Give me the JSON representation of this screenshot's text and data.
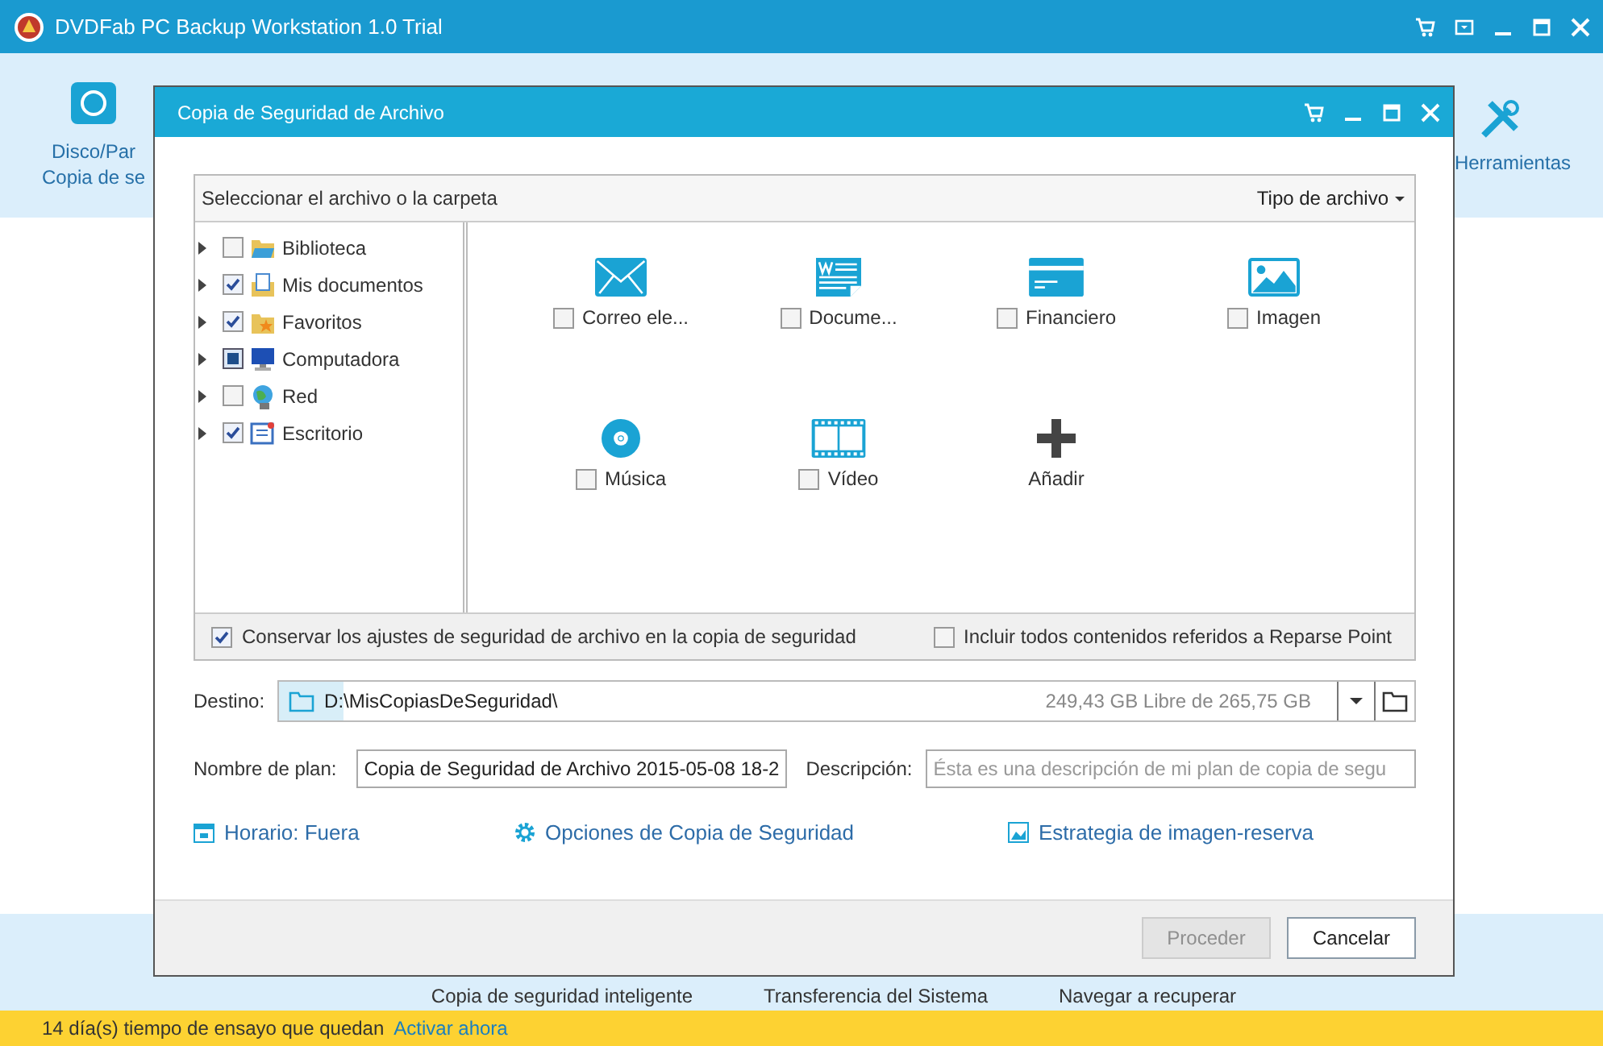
{
  "app": {
    "title": "DVDFab PC Backup Workstation 1.0 Trial",
    "toolbar_left": [
      "Disco/Par",
      "Copia de se"
    ],
    "toolbar_right": "Herramientas",
    "bottom_links": [
      "Copia de seguridad inteligente",
      "Transferencia del Sistema",
      "Navegar a recuperar"
    ],
    "status_bar": {
      "text": "14  día(s) tiempo de ensayo que quedan",
      "link": "Activar ahora"
    }
  },
  "dialog": {
    "title": "Copia de Seguridad de Archivo",
    "panel_title": "Seleccionar el archivo o la carpeta",
    "filter": "Tipo de archivo",
    "tree": [
      {
        "label": "Biblioteca",
        "checked": false,
        "partial": false,
        "kind": "library"
      },
      {
        "label": "Mis documentos",
        "checked": true,
        "partial": false,
        "kind": "documents"
      },
      {
        "label": "Favoritos",
        "checked": true,
        "partial": false,
        "kind": "favorites"
      },
      {
        "label": "Computadora",
        "checked": false,
        "partial": true,
        "kind": "computer"
      },
      {
        "label": "Red",
        "checked": false,
        "partial": false,
        "kind": "network"
      },
      {
        "label": "Escritorio",
        "checked": true,
        "partial": false,
        "kind": "desktop"
      }
    ],
    "file_types": [
      {
        "label": "Correo ele...",
        "kind": "mail",
        "checked": false
      },
      {
        "label": "Docume...",
        "kind": "document",
        "checked": false
      },
      {
        "label": "Financiero",
        "kind": "finance",
        "checked": false
      },
      {
        "label": "Imagen",
        "kind": "image",
        "checked": false
      },
      {
        "label": "Música",
        "kind": "music",
        "checked": false
      },
      {
        "label": "Vídeo",
        "kind": "video",
        "checked": false
      },
      {
        "label": "Añadir",
        "kind": "add"
      }
    ],
    "options": [
      {
        "label": "Conservar los ajustes de seguridad de archivo en la copia de seguridad",
        "checked": true
      },
      {
        "label": "Incluir todos contenidos referidos a Reparse Point",
        "checked": false
      }
    ],
    "destination": {
      "label": "Destino:",
      "value": "D:\\MisCopiasDeSeguridad\\",
      "free": "249,43 GB Libre de 265,75 GB"
    },
    "plan_name": {
      "label": "Nombre de plan:",
      "value": "Copia de Seguridad de Archivo 2015-05-08 18-2"
    },
    "description": {
      "label": "Descripción:",
      "placeholder": "Ésta es una descripción de mi plan de copia de segu"
    },
    "links": [
      {
        "label": "Horario: Fuera",
        "kind": "calendar"
      },
      {
        "label": "Opciones de Copia de Seguridad",
        "kind": "gear"
      },
      {
        "label": "Estrategia de imagen-reserva",
        "kind": "image"
      }
    ],
    "buttons": [
      {
        "label": "Proceder",
        "disabled": true
      },
      {
        "label": "Cancelar",
        "disabled": false
      }
    ]
  }
}
